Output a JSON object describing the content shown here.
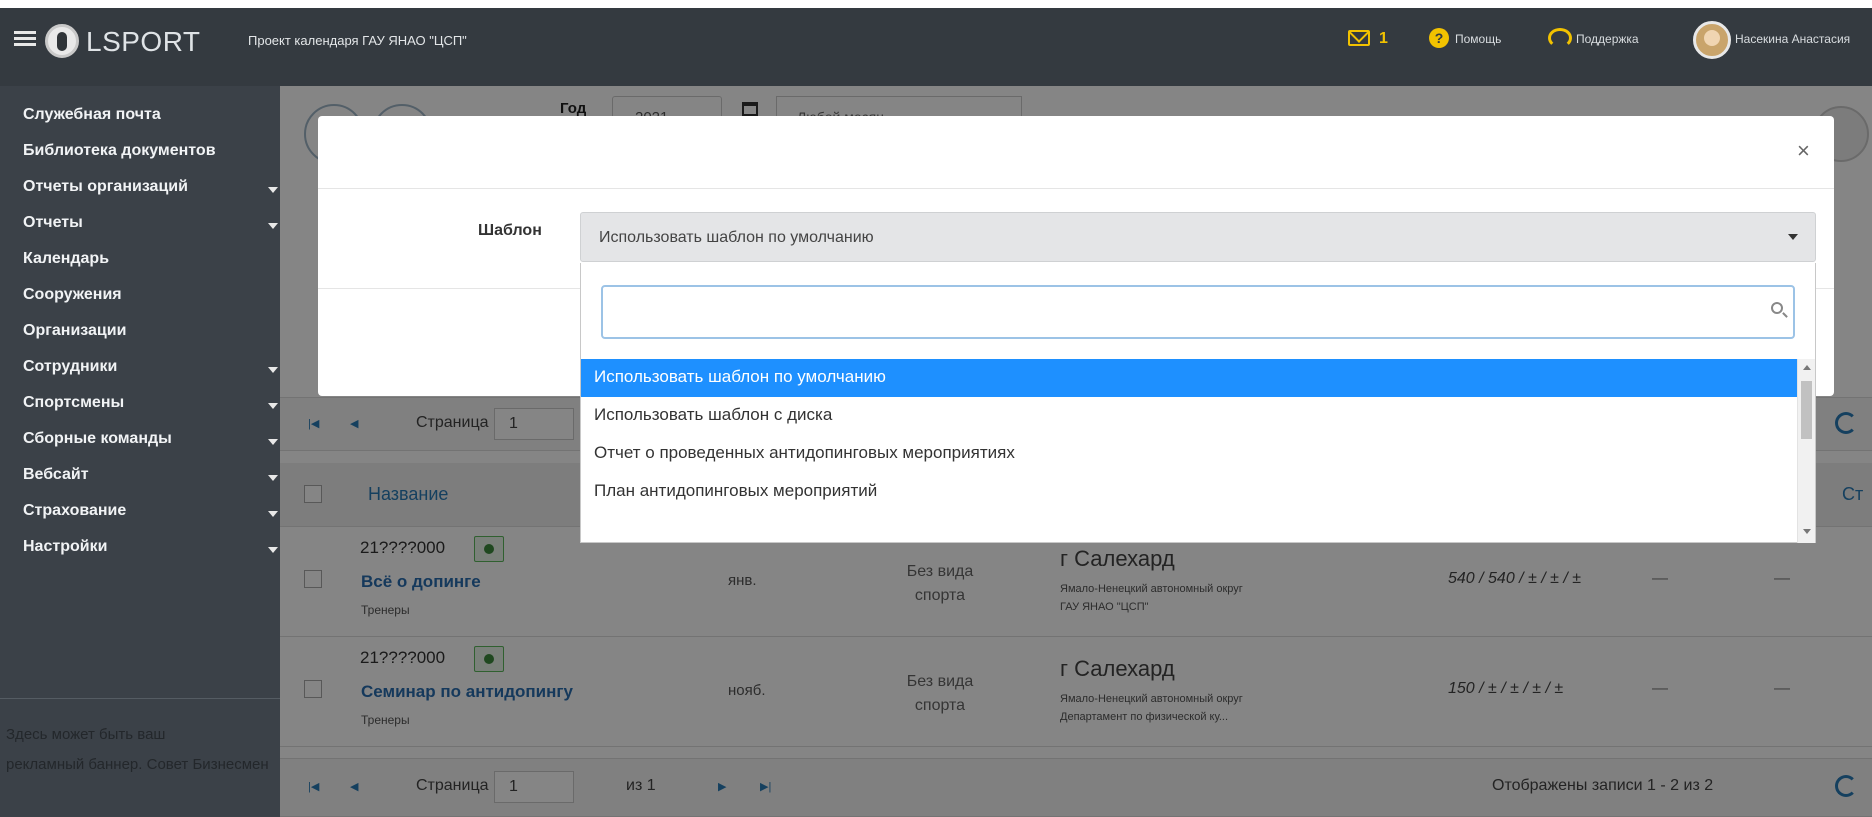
{
  "header": {
    "brand": "LSPORT",
    "project_title": "Проект календаря ГАУ ЯНАО \"ЦСП\"",
    "mail_count": "1",
    "help_label": "Помощь",
    "support_label": "Поддержка",
    "user_name": "Насекина Анастасия"
  },
  "sidebar": {
    "items": [
      {
        "label": "Служебная почта"
      },
      {
        "label": "Библиотека документов"
      },
      {
        "label": "Отчеты организаций"
      },
      {
        "label": "Отчеты"
      },
      {
        "label": "Календарь"
      },
      {
        "label": "Сооружения"
      },
      {
        "label": "Организации"
      },
      {
        "label": "Сотрудники"
      },
      {
        "label": "Спортсмены"
      },
      {
        "label": "Сборные команды"
      },
      {
        "label": "Вебсайт"
      },
      {
        "label": "Страхование"
      },
      {
        "label": "Настройки"
      }
    ],
    "footer_line1": "Здесь может быть ваш",
    "footer_line2": "рекламный баннер. Совет Бизнесмен"
  },
  "filters": {
    "year_label": "Год",
    "year_value": "2021",
    "month_value": "Любой месяц"
  },
  "pager": {
    "page_label": "Страница",
    "page_value": "1",
    "of_label": "из 1",
    "records_info": "Отображены записи 1 - 2 из 2"
  },
  "grid": {
    "header_name": "Название",
    "header_last": "Ст",
    "rows": [
      {
        "code": "21????000",
        "title": "Всё о допинге",
        "audience": "Тренеры",
        "month": "янв.",
        "sport_line1": "Без вида",
        "sport_line2": "спорта",
        "city": "г Салехард",
        "region_line1": "Ямало-Ненецкий автономный округ",
        "region_line2": "ГАУ ЯНАО \"ЦСП\"",
        "capacity": "540 / 540 / ± / ± / ±",
        "dash1": "—",
        "dash2": "—"
      },
      {
        "code": "21????000",
        "title": "Семинар по антидопингу",
        "audience": "Тренеры",
        "month": "нояб.",
        "sport_line1": "Без вида",
        "sport_line2": "спорта",
        "city": "г Салехард",
        "region_line1": "Ямало-Ненецкий автономный округ",
        "region_line2": "Департамент по физической ку...",
        "capacity": "150 / ± / ± / ± / ±",
        "dash1": "—",
        "dash2": "—"
      }
    ]
  },
  "modal": {
    "close_symbol": "×",
    "template_label": "Шаблон",
    "template_selected": "Использовать шаблон по умолчанию",
    "search_value": "",
    "options": [
      {
        "label": "Использовать шаблон по умолчанию",
        "selected": true
      },
      {
        "label": "Использовать шаблон с диска",
        "selected": false
      },
      {
        "label": "Отчет о проведенных антидопинговых мероприятиях",
        "selected": false
      },
      {
        "label": "План антидопинговых мероприятий",
        "selected": false
      }
    ]
  },
  "colors": {
    "topbar": "#343a40",
    "sidebar": "#3b4148",
    "accent_yellow": "#f2c200",
    "selected_option": "#1e90ff",
    "link_blue": "#2a6db0"
  }
}
